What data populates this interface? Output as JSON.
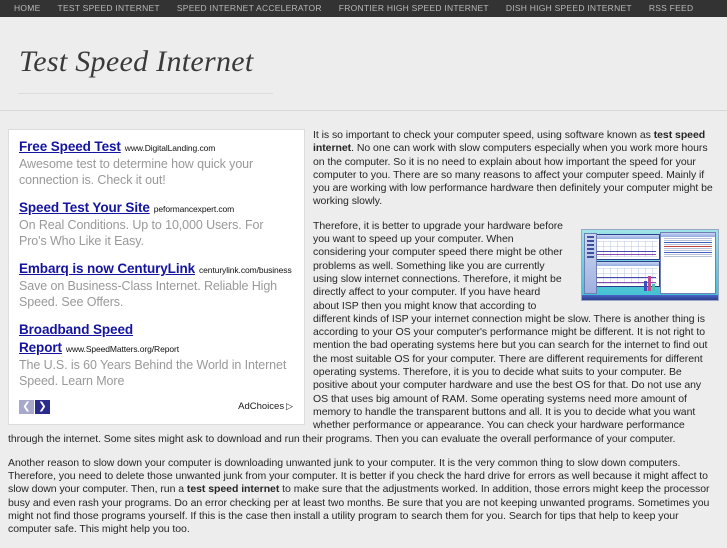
{
  "nav": {
    "items": [
      {
        "label": "HOME"
      },
      {
        "label": "TEST SPEED INTERNET"
      },
      {
        "label": "SPEED INTERNET ACCELERATOR"
      },
      {
        "label": "FRONTIER HIGH SPEED INTERNET"
      },
      {
        "label": "DISH HIGH SPEED INTERNET"
      },
      {
        "label": "RSS FEED"
      }
    ]
  },
  "header": {
    "site_title": "Test Speed Internet"
  },
  "ads": {
    "units": [
      {
        "title": "Free Speed Test",
        "url": "www.DigitalLanding.com",
        "desc": "Awesome test to determine how quick your connection is. Check it out!"
      },
      {
        "title": "Speed Test Your Site",
        "url": "peformancexpert.com",
        "desc": "On Real Conditions. Up to 10,000 Users. For Pro's Who Like it Easy."
      },
      {
        "title": "Embarq is now CenturyLink",
        "url": "centurylink.com/business",
        "desc": "Save on Business-Class Internet. Reliable High Speed. See Offers."
      },
      {
        "title": "Broadband Speed Report",
        "url": "www.SpeedMatters.org/Report",
        "desc": "The U.S. is 60 Years Behind the World in Internet Speed. Learn More"
      }
    ],
    "prev_label": "❮",
    "next_label": "❯",
    "adchoices_label": "AdChoices",
    "adchoices_icon": "▷"
  },
  "article": {
    "p1_a": "It is so important to check your computer speed, using software known as ",
    "p1_bold": "test speed internet",
    "p1_b": ". No one can work with slow computers especially when you work more hours on the computer. So it is no need to explain about how important the speed for your computer to you. There are so many reasons to affect your computer speed. Mainly if you are working with low performance hardware then definitely your computer might be working slowly.",
    "p2": "Therefore, it is better to upgrade your hardware before you want to speed up your computer. When considering your computer speed there might be other problems as well. Something like you are currently using slow internet connections. Therefore, it might be directly affect to your computer. If you have heard about ISP then you might know that according to different kinds of ISP your internet connection might be slow. There is another thing is according to your OS your computer's performance might be different. It is not right to mention the bad operating systems here but you can search for the internet to find out the most suitable OS for your computer. There are different requirements for different operating systems. Therefore, it is you to decide what suits to your computer. Be positive about your computer hardware and use the best OS for that. Do not use any OS that uses big amount of RAM. Some operating systems need more amount of memory to handle the transparent buttons and all. It is you to decide what you want whether performance or appearance. You can check your hardware performance through the internet. Some sites might ask to download and run their programs. Then you can evaluate the overall performance of your computer.",
    "p3_a": "Another reason to slow down your computer is downloading unwanted junk to your computer. It is the very common thing to slow down computers. Therefore, you need to delete those unwanted junk from your computer. It is better if you check the hard drive for errors as well because it might affect to slow down your computer. Then, run a ",
    "p3_bold": "test speed internet",
    "p3_b": " to make sure that the adjustments worked. In addition, those errors might keep the processor busy and even rash your programs. Do an error checking per at least two months. Be sure that you are not keeping unwanted programs. Sometimes you might not find those programs yourself. If this is the case then install a utility program to search them for you. Search for tips that help to keep your computer safe. This might help you too."
  }
}
